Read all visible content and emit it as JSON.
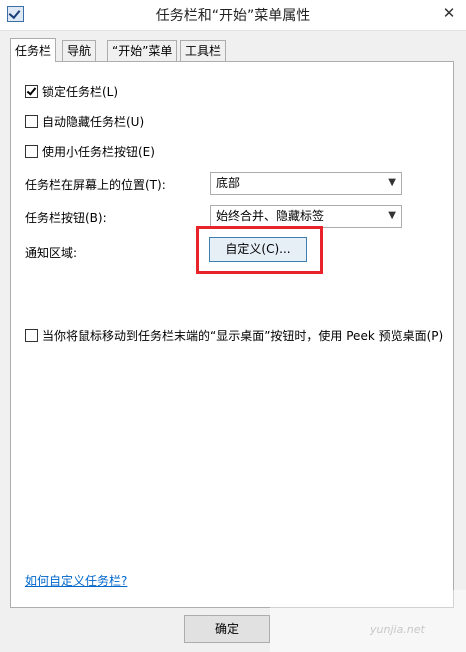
{
  "window": {
    "title": "任务栏和“开始”菜单属性",
    "close_icon": "close-icon"
  },
  "tabs": [
    {
      "label": "任务栏",
      "active": true
    },
    {
      "label": "导航"
    },
    {
      "label": "“开始”菜单"
    },
    {
      "label": "工具栏"
    }
  ],
  "options": {
    "lock": {
      "label": "锁定任务栏(L)",
      "checked": true
    },
    "autohide": {
      "label": "自动隐藏任务栏(U)",
      "checked": false
    },
    "small": {
      "label": "使用小任务栏按钮(E)",
      "checked": false
    }
  },
  "location": {
    "label": "任务栏在屏幕上的位置(T):",
    "value": "底部"
  },
  "buttons_combine": {
    "label": "任务栏按钮(B):",
    "value": "始终合并、隐藏标签"
  },
  "notification": {
    "label": "通知区域:",
    "button_label": "自定义(C)..."
  },
  "peek": {
    "label": "当你将鼠标移动到任务栏末端的“显示桌面”按钮时，使用 Peek 预览桌面(P)",
    "checked": false
  },
  "help_link": "如何自定义任务栏?",
  "ok_label": "确定",
  "watermark": "yunjia.net",
  "colors": {
    "highlight": "#e8232a",
    "link": "#0066cc"
  }
}
